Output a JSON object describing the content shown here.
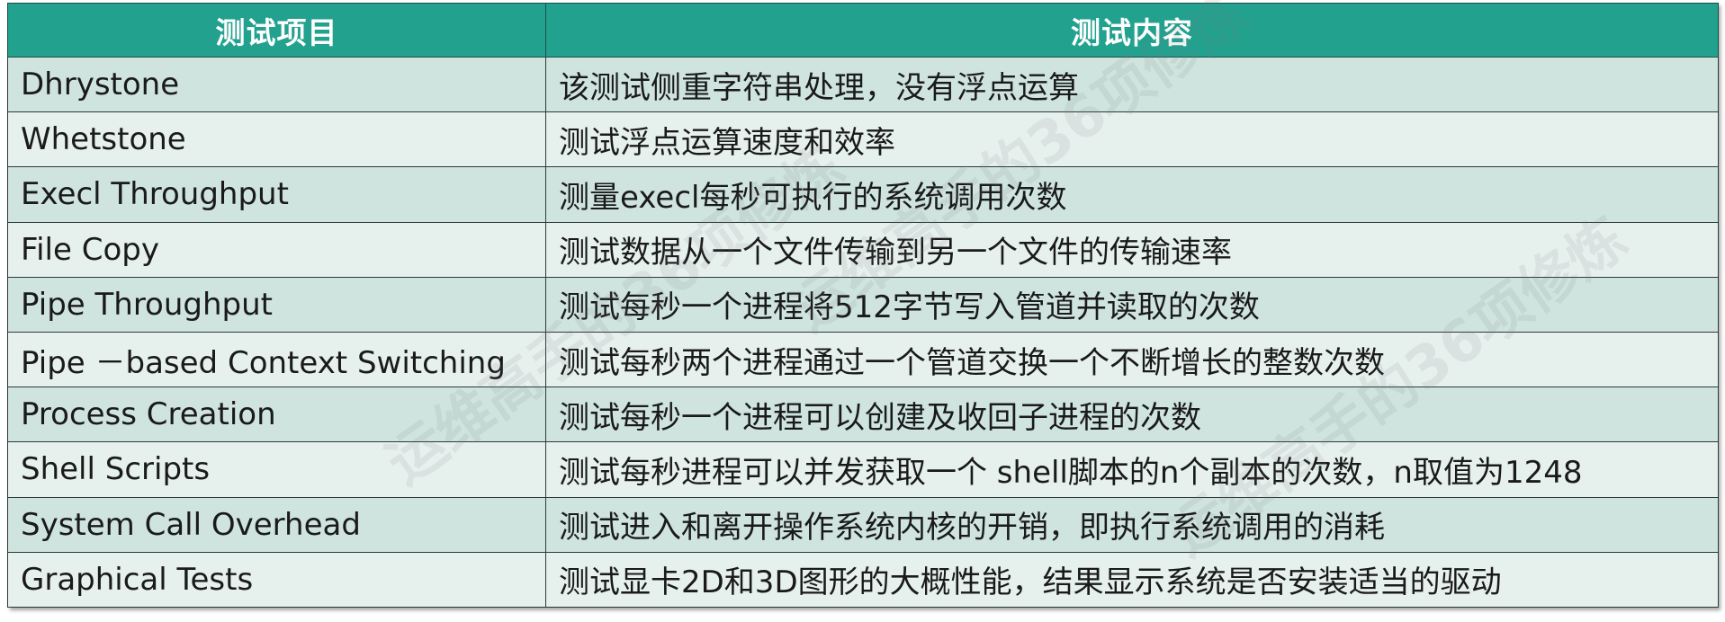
{
  "colors": {
    "header_bg": "#22a18f",
    "row_odd_bg": "#cfe4df",
    "row_even_bg": "#e6f1ee"
  },
  "table": {
    "headers": [
      "测试项目",
      "测试内容"
    ],
    "rows": [
      [
        "Dhrystone",
        "该测试侧重字符串处理，没有浮点运算"
      ],
      [
        "Whetstone",
        "测试浮点运算速度和效率"
      ],
      [
        "Execl Throughput",
        "测量execl每秒可执行的系统调用次数"
      ],
      [
        "File Copy",
        "测试数据从一个文件传输到另一个文件的传输速率"
      ],
      [
        "Pipe Throughput",
        "测试每秒一个进程将512字节写入管道并读取的次数"
      ],
      [
        "Pipe －based Context Switching",
        "测试每秒两个进程通过一个管道交换一个不断增长的整数次数"
      ],
      [
        "Process Creation",
        "测试每秒一个进程可以创建及收回子进程的次数"
      ],
      [
        "Shell Scripts",
        "测试每秒进程可以并发获取一个 shell脚本的n个副本的次数，n取值为1248"
      ],
      [
        "System Call Overhead",
        "测试进入和离开操作系统内核的开销，即执行系统调用的消耗"
      ],
      [
        "Graphical Tests",
        "测试显卡2D和3D图形的大概性能，结果显示系统是否安装适当的驱动"
      ]
    ]
  },
  "watermark": "运维高手的36项修炼"
}
